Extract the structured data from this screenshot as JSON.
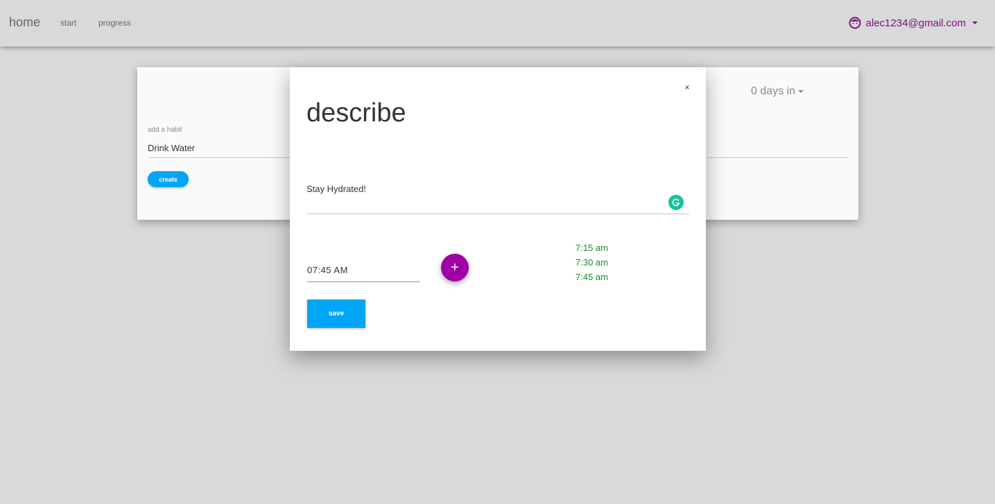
{
  "nav": {
    "home": "home",
    "start": "start",
    "progress": "progress",
    "user_email": "alec1234@gmail.com"
  },
  "card": {
    "add_label": "add a habit",
    "habit_value": "Drink Water",
    "create_label": "create",
    "days_in": "0 days in"
  },
  "modal": {
    "close_label": "×",
    "title": "describe",
    "description": "Stay Hydrated!",
    "time_value": "07:45 AM",
    "add_time_label": "+",
    "times": [
      "7:15 am",
      "7:30 am",
      "7:45 am"
    ],
    "save_label": "save"
  },
  "colors": {
    "accent_blue": "#00a6f5",
    "accent_purple": "#a100a8",
    "user_purple": "#7b0f7b",
    "time_green": "#1f8a1f",
    "grammarly": "#15c39a"
  },
  "icons": {
    "user": "user-face-icon",
    "grammarly": "grammarly-icon",
    "dropdown": "caret-down-icon"
  }
}
